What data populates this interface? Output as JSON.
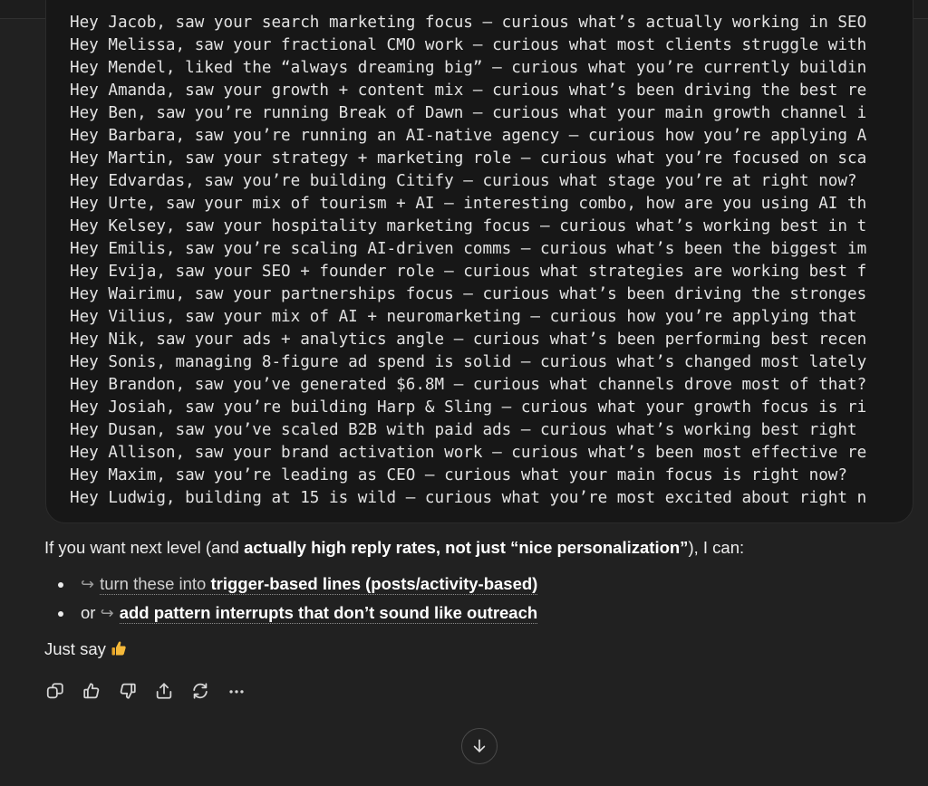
{
  "code_block": {
    "lines": [
      "Hey Jacob, saw your search marketing focus — curious what’s actually working in SEO",
      "Hey Melissa, saw your fractional CMO work — curious what most clients struggle with",
      "Hey Mendel, liked the “always dreaming big” — curious what you’re currently building",
      "Hey Amanda, saw your growth + content mix — curious what’s been driving the best results",
      "Hey Ben, saw you’re running Break of Dawn — curious what your main growth channel is",
      "Hey Barbara, saw you’re running an AI-native agency — curious how you’re applying AI",
      "Hey Martin, saw your strategy + marketing role — curious what you’re focused on scaling",
      "Hey Edvardas, saw you’re building Citify — curious what stage you’re at right now?",
      "Hey Urte, saw your mix of tourism + AI — interesting combo, how are you using AI there",
      "Hey Kelsey, saw your hospitality marketing focus — curious what’s working best in that",
      "Hey Emilis, saw you’re scaling AI-driven comms — curious what’s been the biggest impact",
      "Hey Evija, saw your SEO + founder role — curious what strategies are working best for",
      "Hey Wairimu, saw your partnerships focus — curious what’s been driving the strongest",
      "Hey Vilius, saw your mix of AI + neuromarketing — curious how you’re applying that in",
      "Hey Nik, saw your ads + analytics angle — curious what’s been performing best recently",
      "Hey Sonis, managing 8-figure ad spend is solid — curious what’s changed most lately?",
      "Hey Brandon, saw you’ve generated $6.8M — curious what channels drove most of that?",
      "Hey Josiah, saw you’re building Harp & Sling — curious what your growth focus is right",
      "Hey Dusan, saw you’ve scaled B2B with paid ads — curious what’s working best right now",
      "Hey Allison, saw your brand activation work — curious what’s been most effective recently",
      "Hey Maxim, saw you’re leading as CEO — curious what your main focus is right now?",
      "Hey Ludwig, building at 15 is wild — curious what you’re most excited about right now"
    ]
  },
  "response": {
    "intro_prefix": "If you want next level (and ",
    "intro_bold": "actually high reply rates, not just “nice personalization”",
    "intro_suffix": "), I can:",
    "bullets": [
      {
        "prefix": "",
        "arrow": "↪",
        "link_plain": "turn these into ",
        "link_bold": "trigger-based lines (posts/activity-based)"
      },
      {
        "prefix": "or ",
        "arrow": "↪",
        "link_plain": "",
        "link_bold": "add pattern interrupts that don’t sound like outreach"
      }
    ],
    "closing_text": "Just say",
    "closing_emoji": "thumbs-up-icon"
  },
  "actions": [
    {
      "name": "copy-icon"
    },
    {
      "name": "thumbs-up-icon"
    },
    {
      "name": "thumbs-down-icon"
    },
    {
      "name": "share-icon"
    },
    {
      "name": "regenerate-icon"
    },
    {
      "name": "more-options-icon"
    }
  ],
  "scroll_button": {
    "icon": "arrow-down-icon"
  },
  "colors": {
    "background": "#212121",
    "code_background": "#171717",
    "text": "#ececec",
    "muted": "#9b9b9b",
    "thumb_emoji": "#f5b93a"
  }
}
